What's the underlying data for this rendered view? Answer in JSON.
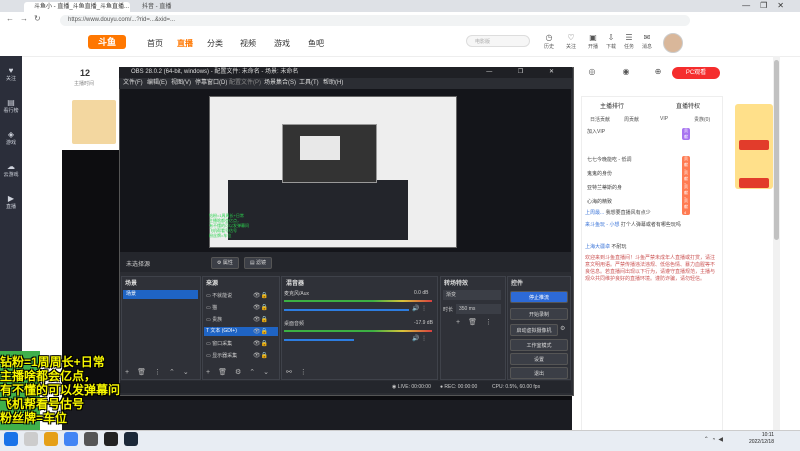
{
  "browser": {
    "tab_active": "斗鱼小 - 直播_斗鱼直播_斗鱼直播...",
    "tab_second": "抖音 - 直播",
    "url": "https://www.douyu.com/...?rid=...&xid=...",
    "win_controls": [
      "—",
      "❐",
      "✕"
    ]
  },
  "site": {
    "logo": "斗鱼",
    "nav": [
      "首页",
      "直播",
      "分类",
      "视频",
      "游戏",
      "鱼吧"
    ],
    "active_nav": "直播",
    "search_placeholder": "电影版",
    "header_icons": [
      {
        "name": "history-icon",
        "label": "历史"
      },
      {
        "name": "follow-icon",
        "label": "关注"
      },
      {
        "name": "download-icon",
        "label": "开播"
      },
      {
        "name": "cart-icon",
        "label": "下载"
      },
      {
        "name": "task-icon",
        "label": "任务"
      },
      {
        "name": "message-icon",
        "label": "消息"
      }
    ]
  },
  "leftbar": [
    {
      "icon": "heart-icon",
      "label": "关注"
    },
    {
      "icon": "video-icon",
      "label": "看行榜"
    },
    {
      "icon": "gift-icon",
      "label": "游戏"
    },
    {
      "icon": "shop-icon",
      "label": "云游戏"
    },
    {
      "icon": "game-icon",
      "label": "直播"
    }
  ],
  "room": {
    "level": "12",
    "sub": "主播时间"
  },
  "obs": {
    "title": "OBS 28.0.2 (64-bit, windows) - 配置文件: 未命名 - 场景: 未命名",
    "menu": [
      "文件(F)",
      "编辑(E)",
      "视图(V)",
      "停靠窗口(D)",
      "配置文件(P)",
      "场景集合(S)",
      "工具(T)",
      "帮助(H)"
    ],
    "no_source": "未选择源",
    "btn_properties": "属性",
    "btn_filters": "滤镜",
    "docks": {
      "scenes": "场景",
      "sources": "来源",
      "mixer": "混音器",
      "transitions": "转场特效",
      "controls": "控件"
    },
    "scene_items": [
      "场景"
    ],
    "source_items": [
      "不就能说",
      "猫",
      "贵族",
      "文本 (GDI+)",
      "窗口采集",
      "显示器采集"
    ],
    "mixer": [
      {
        "name": "麦克风/Aux",
        "level": "0.0 dB"
      },
      {
        "name": "桌面音频",
        "level": "-17.9 dB"
      }
    ],
    "transition_type": "渐变",
    "duration_label": "时长",
    "duration": "350 ms",
    "controls": [
      "停止推流",
      "开始录制",
      "启动虚拟摄像机",
      "工作室模式",
      "设置",
      "退出"
    ],
    "status_live": "LIVE: 00:00:00",
    "status_rec": "REC: 00:00:00",
    "status_cpu": "CPU: 0.5%, 60.00 fps"
  },
  "right_panel": {
    "pc_button": "PC观看",
    "top_icons": [
      {
        "name": "gift-icon",
        "label": "..."
      },
      {
        "name": "share-icon",
        "label": "..."
      },
      {
        "name": "report-icon",
        "label": "..."
      }
    ],
    "tabs_top": [
      "主播排行",
      "直播特权"
    ],
    "tabs": [
      "日活贡献",
      "周贡献",
      "VIP",
      "贵族(0)"
    ],
    "rank": [
      {
        "label": "加入VIP",
        "tag": "贡献"
      },
      {
        "label": "七七今晚能吃 - 低调",
        "tag": "贡献1"
      },
      {
        "label": "鬼鬼的身份",
        "tag": "贡献2"
      },
      {
        "label": "亚特兰蒂斯的身",
        "tag": "贡献3"
      },
      {
        "label": "心海的精致",
        "tag": "贡献4"
      }
    ],
    "chat": [
      {
        "name": "上周最...",
        "text": "我想要直播风有点少"
      },
      {
        "name": "来斗鱼玩 - 小想",
        "text": "打个人弹幕或者有哪些玩吗"
      },
      {
        "name": "上海大疆卓",
        "text": "不耐玩"
      }
    ],
    "notice": "欢迎来到斗鱼直播间！斗鱼严禁未成年人直播或打赏，请注意文明用语。严禁传播违法违规、低俗色情、暴力血腥等不良信息。若直播间出现以下行为，请遵守直播规范，主播与观众共同维护良好的直播环境。谨防诈骗，请勿轻信。"
  },
  "overlay": {
    "lines": [
      "钻粉=1周周长+日常",
      "主播啥都会亿点，",
      "有不懂的可以发弹幕问",
      "飞机帮看号估号",
      "粉丝牌=车位"
    ]
  },
  "taskbar": {
    "time": "10:11",
    "date": "2022/12/18"
  }
}
